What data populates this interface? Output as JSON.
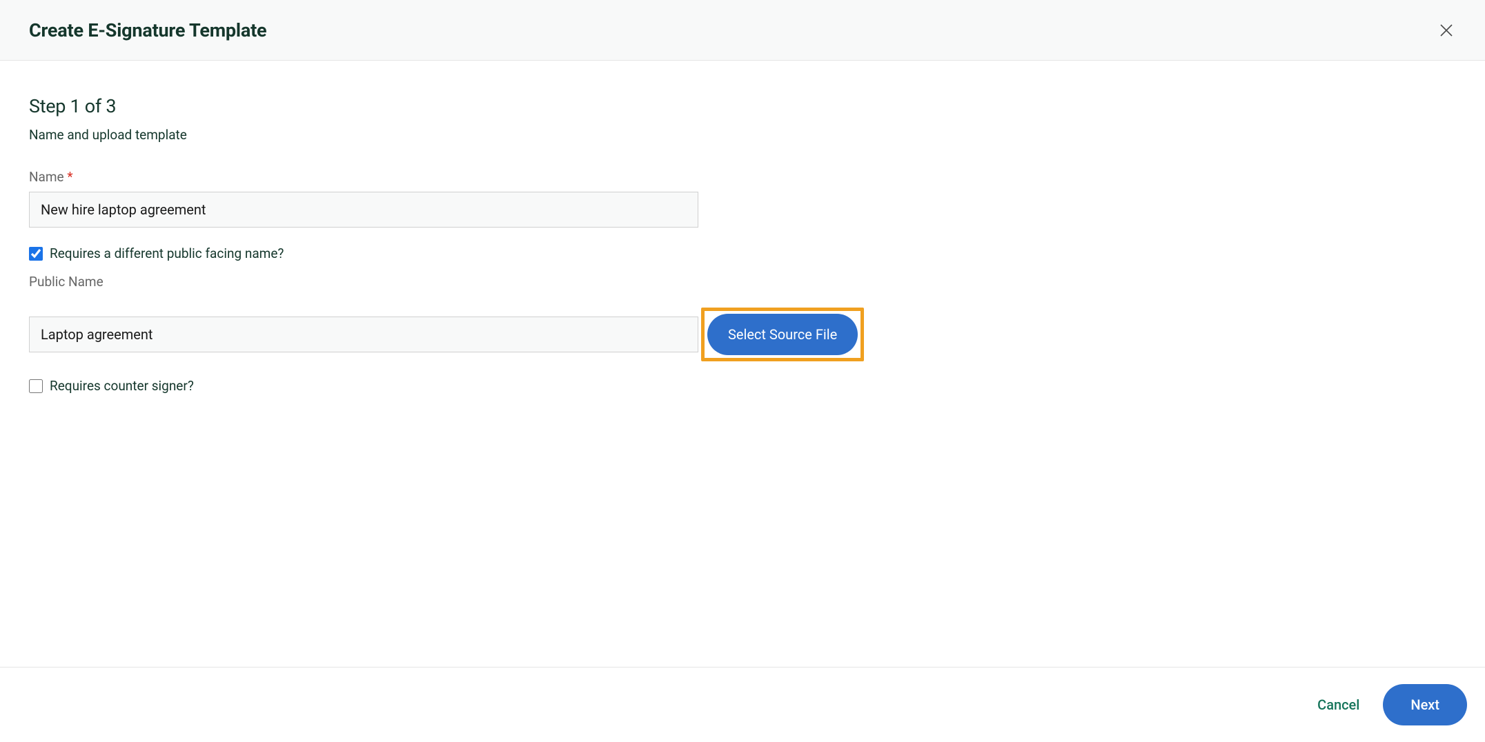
{
  "header": {
    "title": "Create E-Signature Template"
  },
  "step": {
    "title": "Step 1 of 3",
    "subtitle": "Name and upload template"
  },
  "form": {
    "name_label": "Name",
    "name_value": "New hire laptop agreement",
    "public_checkbox_label": "Requires a different public facing name?",
    "public_checkbox_checked": true,
    "public_name_label": "Public Name",
    "public_name_value": "Laptop agreement",
    "select_file_label": "Select Source File",
    "counter_signer_label": "Requires counter signer?",
    "counter_signer_checked": false
  },
  "footer": {
    "cancel_label": "Cancel",
    "next_label": "Next"
  }
}
